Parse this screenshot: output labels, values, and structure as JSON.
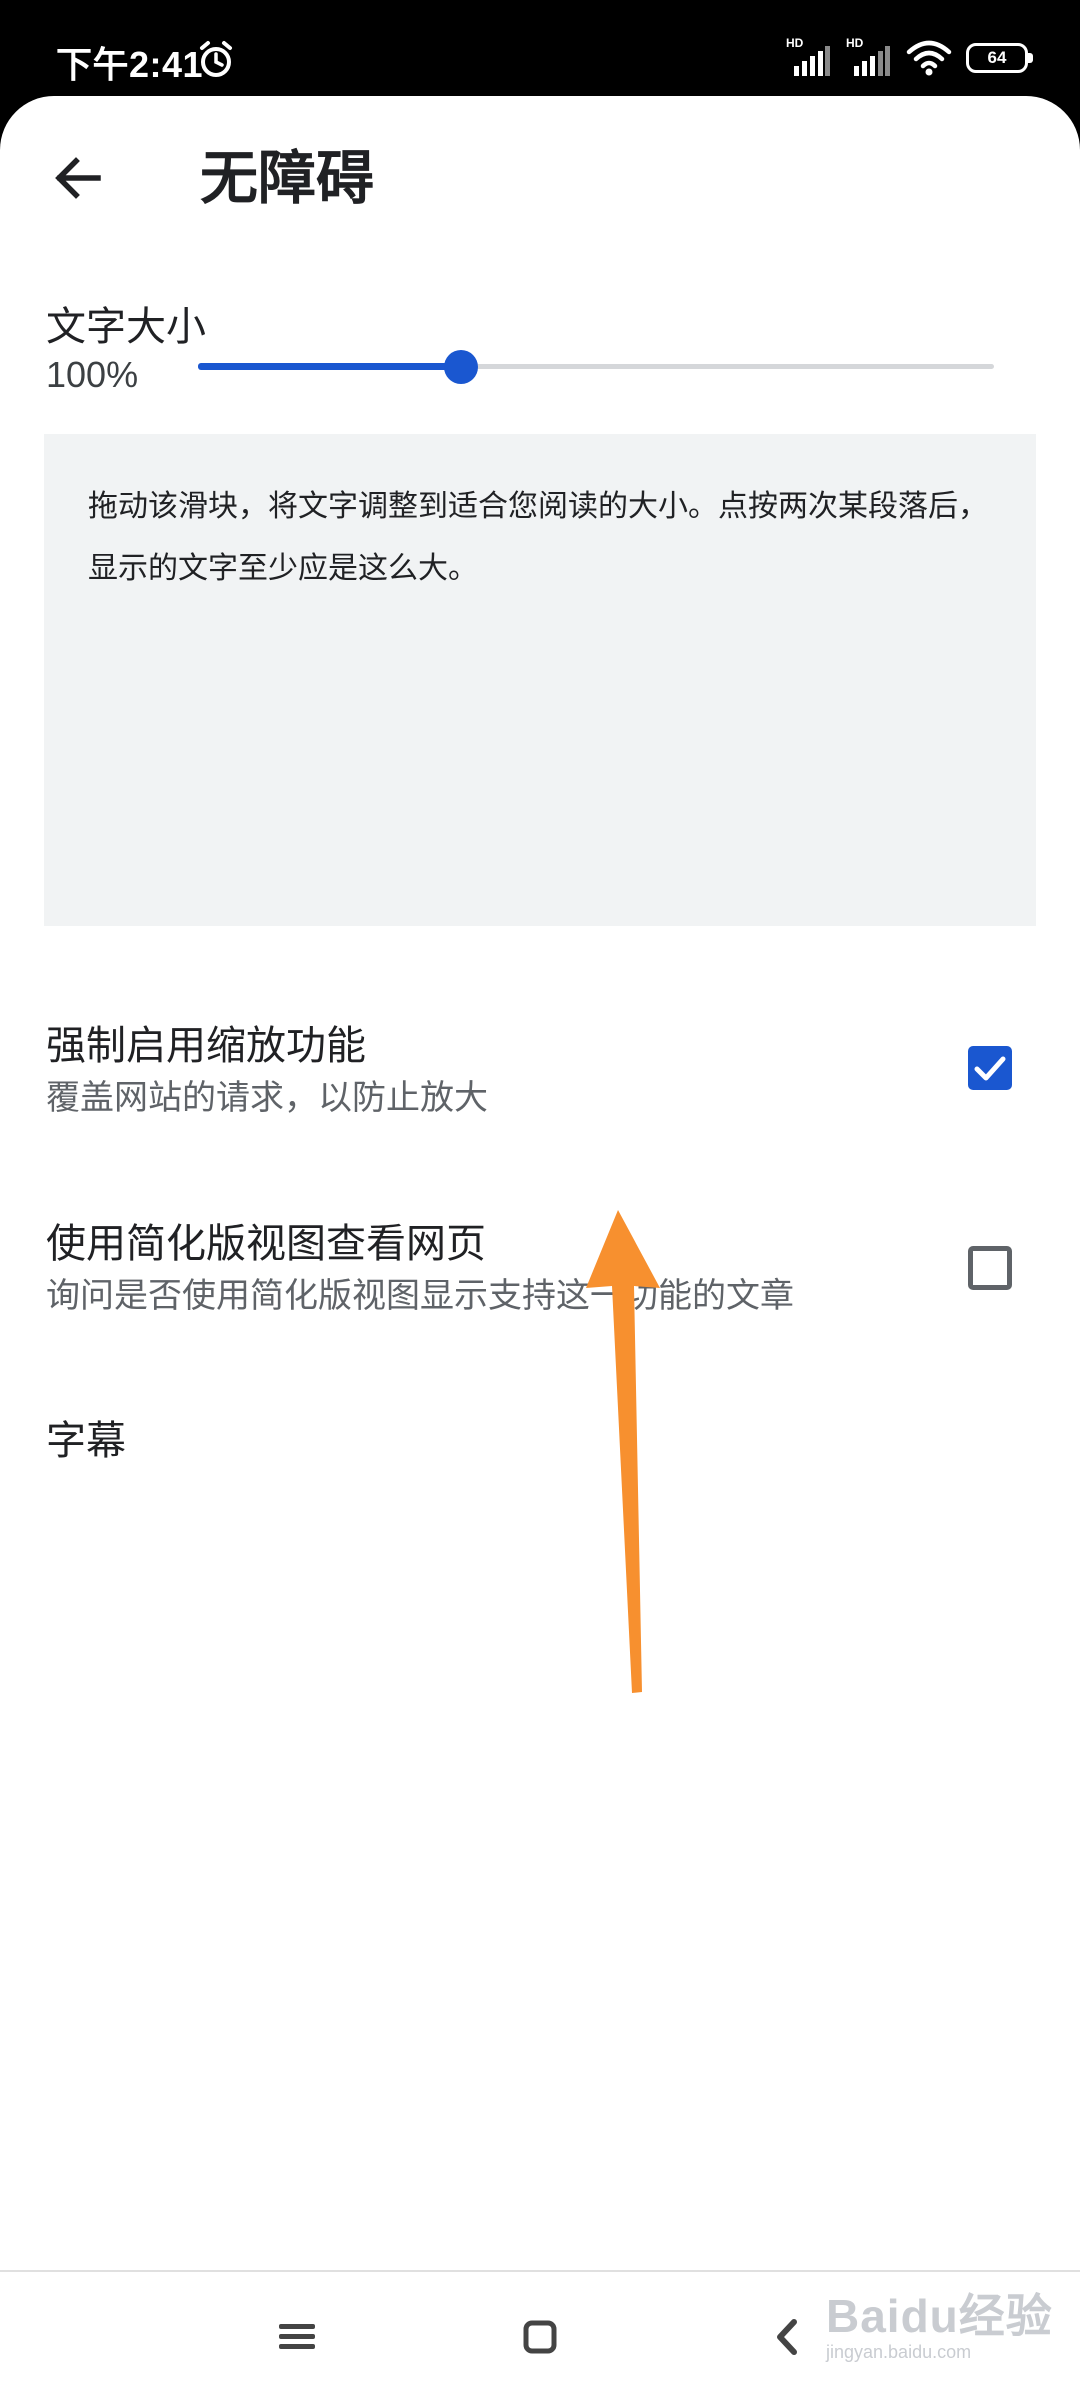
{
  "status_bar": {
    "time": "下午2:41",
    "signal1_label": "HD",
    "signal2_label": "HD",
    "battery": "64"
  },
  "app_bar": {
    "title": "无障碍"
  },
  "text_scaling": {
    "label": "文字大小",
    "value": "100%",
    "level_fraction": 0.33,
    "preview_text": "拖动该滑块，将文字调整到适合您阅读的大小。点按两次某段落后，显示的文字至少应是这么大。"
  },
  "preferences": [
    {
      "title": "强制启用缩放功能",
      "summary": "覆盖网站的请求，以防止放大",
      "checked": true
    },
    {
      "title": "使用简化版视图查看网页",
      "summary": "询问是否使用简化版视图显示支持这一功能的文章",
      "checked": false
    }
  ],
  "captions": {
    "label": "字幕"
  },
  "annotation": {
    "color": "#f7902f"
  },
  "colors": {
    "accent": "#1a57d0"
  },
  "nav_bar": {
    "icons": [
      "menu-icon",
      "home-icon",
      "back-icon"
    ]
  },
  "watermark": {
    "main": "Baidu经验",
    "sub": "jingyan.baidu.com"
  }
}
